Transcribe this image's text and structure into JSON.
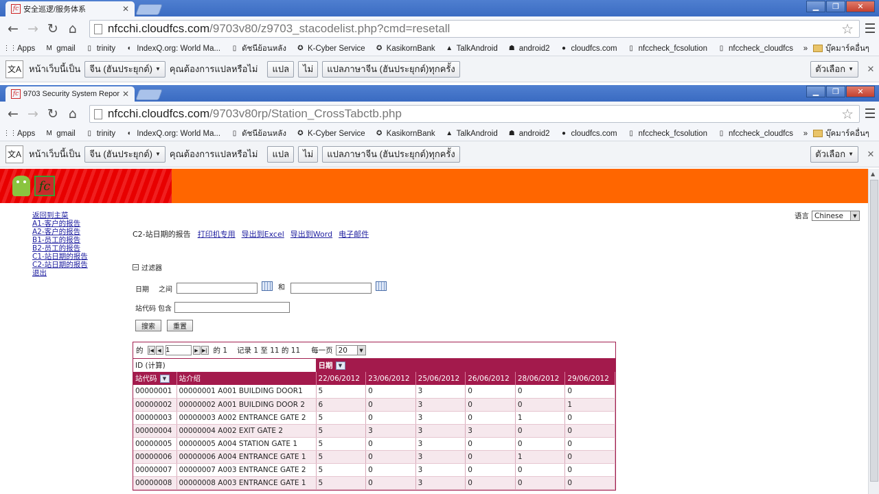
{
  "browser1": {
    "tab_title": "安全巡逻/服务体系",
    "url_host": "nfcchi.cloudfcs.com",
    "url_path": "/9703v80/z9703_stacodelist.php?cmd=resetall"
  },
  "browser2": {
    "tab_title": "9703 Security System Repor",
    "url_host": "nfcchi.cloudfcs.com",
    "url_path": "/9703v80rp/Station_CrossTabctb.php"
  },
  "bookmarks": [
    "Apps",
    "gmail",
    "trinity",
    "IndexQ.org: World Ma...",
    "ดัชนีย้อนหลัง",
    "K-Cyber Service",
    "KasikornBank",
    "TalkAndroid",
    "android2",
    "cloudfcs.com",
    "nfccheck_fcsolution",
    "nfccheck_cloudfcs"
  ],
  "bookmarks_more": "»",
  "bookmarks_other": "บุ๊คมาร์คอื่นๆ",
  "translate": {
    "prefix": "หน้าเว็บนี้เป็น",
    "language": "จีน (ฮันประยุกต์)",
    "question": "คุณต้องการแปลหรือไม่",
    "translate_btn": "แปล",
    "no_btn": "ไม่",
    "always_btn": "แปลภาษาจีน (ฮันประยุกต์)ทุกครั้ง",
    "options_btn": "ตัวเลือก"
  },
  "sidebar": [
    "返回到主菜",
    "A1-客户的报告",
    "A2-客户的报告",
    "B1-员工的报告",
    "B2-员工的报告",
    "C1-站日期的报告",
    "C2-站日期的报告",
    "退出"
  ],
  "language_label": "语言",
  "language_value": "Chinese",
  "report": {
    "title": "C2-站日期的报告",
    "links": [
      "打印机专用",
      "导出到Excel",
      "导出到Word",
      "电子邮件"
    ]
  },
  "filter": {
    "header": "过滤器",
    "date_label": "日期",
    "between": "之间",
    "and": "和",
    "station_label": "站代码",
    "contains": "包含",
    "search_btn": "搜索",
    "reset_btn": "重置"
  },
  "pager": {
    "page_prefix": "的",
    "page_value": "1",
    "of_label": "的 1",
    "records": "记录 1 至 11 的 11",
    "per_page_label": "每一页",
    "per_page": "20"
  },
  "grid": {
    "id_label": "ID (计算)",
    "date_group": "日期",
    "col_station": "站代码",
    "col_desc": "站介绍",
    "dates": [
      "22/06/2012",
      "23/06/2012",
      "25/06/2012",
      "26/06/2012",
      "28/06/2012",
      "29/06/2012"
    ],
    "rows": [
      {
        "code": "00000001",
        "desc": "00000001 A001 BUILDING DOOR1",
        "v": [
          "5",
          "0",
          "3",
          "0",
          "0",
          "0"
        ]
      },
      {
        "code": "00000002",
        "desc": "00000002 A001 BUILDING DOOR 2",
        "v": [
          "6",
          "0",
          "3",
          "0",
          "0",
          "1"
        ]
      },
      {
        "code": "00000003",
        "desc": "00000003 A002 ENTRANCE GATE 2",
        "v": [
          "5",
          "0",
          "3",
          "0",
          "1",
          "0"
        ]
      },
      {
        "code": "00000004",
        "desc": "00000004 A002 EXIT GATE 2",
        "v": [
          "5",
          "3",
          "3",
          "3",
          "0",
          "0"
        ]
      },
      {
        "code": "00000005",
        "desc": "00000005 A004 STATION GATE 1",
        "v": [
          "5",
          "0",
          "3",
          "0",
          "0",
          "0"
        ]
      },
      {
        "code": "00000006",
        "desc": "00000006 A004 ENTRANCE GATE 1",
        "v": [
          "5",
          "0",
          "3",
          "0",
          "1",
          "0"
        ]
      },
      {
        "code": "00000007",
        "desc": "00000007 A003 ENTRANCE GATE 2",
        "v": [
          "5",
          "0",
          "3",
          "0",
          "0",
          "0"
        ]
      },
      {
        "code": "00000008",
        "desc": "00000008 A003 ENTRANCE GATE 1",
        "v": [
          "5",
          "0",
          "3",
          "0",
          "0",
          "0"
        ]
      }
    ]
  }
}
